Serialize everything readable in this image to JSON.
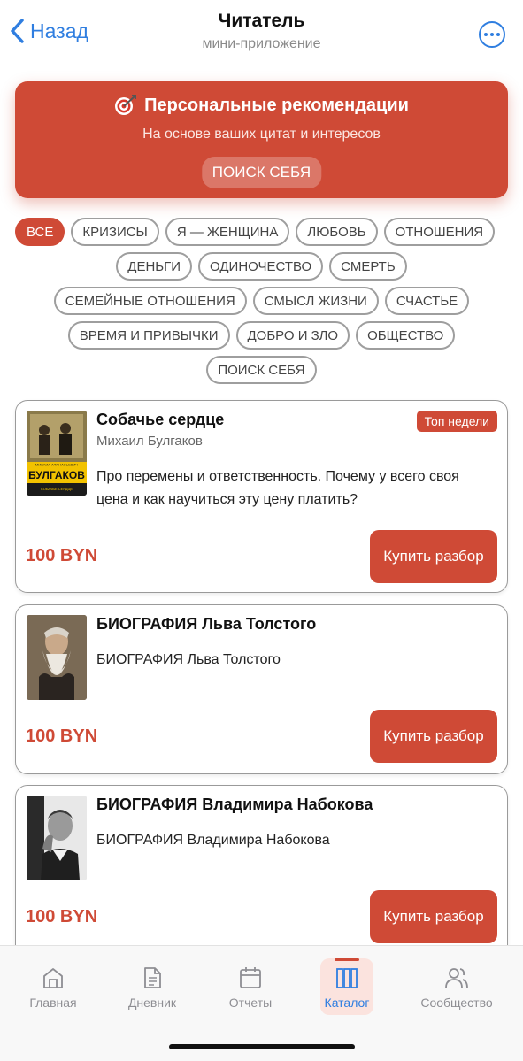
{
  "header": {
    "back_label": "Назад",
    "title": "Читатель",
    "subtitle": "мини-приложение"
  },
  "banner": {
    "title": "Персональные рекомендации",
    "subtitle": "На основе ваших цитат и интересов",
    "chip": "ПОИСК СЕБЯ"
  },
  "tags": [
    "ВСЕ",
    "КРИЗИСЫ",
    "Я — ЖЕНЩИНА",
    "ЛЮБОВЬ",
    "ОТНОШЕНИЯ",
    "ДЕНЬГИ",
    "ОДИНОЧЕСТВО",
    "СМЕРТЬ",
    "СЕМЕЙНЫЕ ОТНОШЕНИЯ",
    "СМЫСЛ ЖИЗНИ",
    "СЧАСТЬЕ",
    "ВРЕМЯ И ПРИВЫЧКИ",
    "ДОБРО И ЗЛО",
    "ОБЩЕСТВО",
    "ПОИСК СЕБЯ"
  ],
  "cards": [
    {
      "title": "Собачье сердце",
      "author": "Михаил Булгаков",
      "badge": "Топ недели",
      "description": "Про перемены и ответственность. Почему у всего своя цена и как научиться эту цену платить?",
      "price": "100 BYN",
      "buy_label": "Купить разбор",
      "cover_author": "МИХАИЛ АФАНАСЬЕВИЧ",
      "cover_name": "БУЛГАКОВ",
      "cover_book": "СОБАЧЬЕ СЕРДЦЕ"
    },
    {
      "title": "БИОГРАФИЯ Льва Толстого",
      "description": "БИОГРАФИЯ Льва Толстого",
      "price": "100 BYN",
      "buy_label": "Купить разбор"
    },
    {
      "title": "БИОГРАФИЯ Владимира Набокова",
      "description": "БИОГРАФИЯ Владимира Набокова",
      "price": "100 BYN",
      "buy_label": "Купить разбор"
    }
  ],
  "tabbar": [
    {
      "label": "Главная",
      "icon": "home-icon"
    },
    {
      "label": "Дневник",
      "icon": "document-icon"
    },
    {
      "label": "Отчеты",
      "icon": "calendar-icon"
    },
    {
      "label": "Каталог",
      "icon": "books-icon",
      "active": true
    },
    {
      "label": "Сообщество",
      "icon": "people-icon"
    }
  ],
  "colors": {
    "accent": "#cf4a36",
    "link": "#2f7ee0",
    "tag_border": "#9e9e9e"
  }
}
